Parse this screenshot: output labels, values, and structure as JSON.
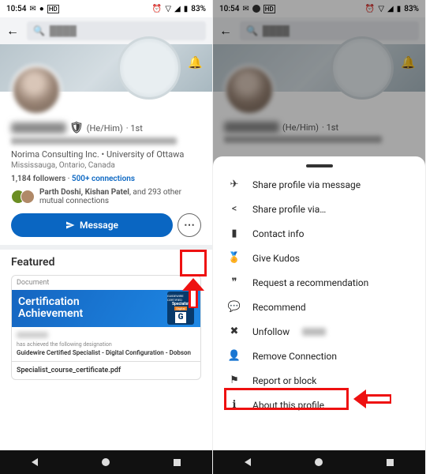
{
  "status": {
    "time": "10:54",
    "battery": "83%"
  },
  "profile": {
    "pronoun": "(He/Him)",
    "degree": "1st",
    "company_line": "Norima Consulting Inc. • University of Ottawa",
    "location": "Mississauga, Ontario, Canada",
    "followers": "1,184",
    "followers_label": "followers",
    "connections": "500+ connections",
    "mutual_names": "Parth Doshi, Kishan Patel",
    "mutual_rest": ", and 293 other mutual connections",
    "message_btn": "Message"
  },
  "featured": {
    "heading": "Featured",
    "doc_tag": "Document",
    "cert_title1": "Certification",
    "cert_title2": "Achievement",
    "badge_top": "GUIDEWIRE CERTIFIED",
    "badge_mid": "Specialist",
    "badge_small": "Digital",
    "desc_small": "has achieved the following designation",
    "desc_title": "Guidewire Certified Specialist - Digital Configuration - Dobson",
    "filename": "Specialist_course_certificate.pdf"
  },
  "menu": {
    "items": [
      {
        "icon": "send",
        "label": "Share profile via message"
      },
      {
        "icon": "share",
        "label": "Share profile via…"
      },
      {
        "icon": "contact",
        "label": "Contact info"
      },
      {
        "icon": "kudos",
        "label": "Give Kudos"
      },
      {
        "icon": "quote",
        "label": "Request a recommendation"
      },
      {
        "icon": "recommend",
        "label": "Recommend"
      },
      {
        "icon": "unfollow",
        "label": "Unfollow"
      },
      {
        "icon": "remove",
        "label": "Remove Connection"
      },
      {
        "icon": "flag",
        "label": "Report or block"
      },
      {
        "icon": "about",
        "label": "About this profile"
      }
    ]
  }
}
